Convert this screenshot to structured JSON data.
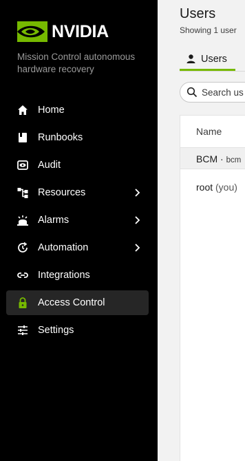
{
  "brand": {
    "name": "NVIDIA",
    "accent": "#76b900"
  },
  "tagline": "Mission Control autonomous hardware recovery",
  "nav": [
    {
      "label": "Home",
      "icon": "home-icon",
      "active": false,
      "has_chevron": false
    },
    {
      "label": "Runbooks",
      "icon": "book-icon",
      "active": false,
      "has_chevron": false
    },
    {
      "label": "Audit",
      "icon": "eye-icon",
      "active": false,
      "has_chevron": false
    },
    {
      "label": "Resources",
      "icon": "hierarchy-icon",
      "active": false,
      "has_chevron": true
    },
    {
      "label": "Alarms",
      "icon": "alarm-icon",
      "active": false,
      "has_chevron": true
    },
    {
      "label": "Automation",
      "icon": "automation-icon",
      "active": false,
      "has_chevron": true
    },
    {
      "label": "Integrations",
      "icon": "link-icon",
      "active": false,
      "has_chevron": false
    },
    {
      "label": "Access Control",
      "icon": "lock-icon",
      "active": true,
      "has_chevron": false
    },
    {
      "label": "Settings",
      "icon": "sliders-icon",
      "active": false,
      "has_chevron": false
    }
  ],
  "page": {
    "title": "Users",
    "subtitle": "Showing 1 user"
  },
  "tabs": [
    {
      "label": "Users",
      "active": true
    }
  ],
  "search": {
    "placeholder": "Search us"
  },
  "table": {
    "columns": [
      "Name"
    ],
    "group": {
      "name": "BCM",
      "separator": " · ",
      "tag": "bcm"
    },
    "rows": [
      {
        "name": "root",
        "suffix": " (you)"
      }
    ]
  }
}
